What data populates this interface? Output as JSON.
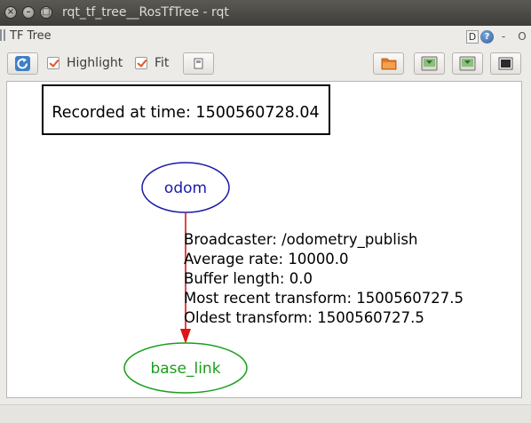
{
  "window": {
    "title": "rqt_tf_tree__RosTfTree - rqt",
    "close_glyph": "×",
    "minimize_glyph": "–",
    "maximize_glyph": "□"
  },
  "panel": {
    "title": "TF Tree",
    "d_button": "D",
    "help_button": "?",
    "dash_button": "-",
    "close_button": "O"
  },
  "toolbar": {
    "refresh_icon": "refresh-icon",
    "highlight_label": "Highlight",
    "highlight_checked": true,
    "fit_label": "Fit",
    "fit_checked": true
  },
  "graph": {
    "recorded_label": "Recorded at time: 1500560728.04",
    "nodes": {
      "parent": {
        "label": "odom",
        "color": "#1a1aa8"
      },
      "child": {
        "label": "base_link",
        "color": "#1a9e1a"
      }
    },
    "edge": {
      "color": "#e01515",
      "lines": [
        "Broadcaster: /odometry_publish",
        "Average rate: 10000.0",
        "Buffer length: 0.0",
        "Most recent transform: 1500560727.5",
        "Oldest transform: 1500560727.5"
      ]
    }
  },
  "colors": {
    "titlebar": "#4a4945",
    "accent_check": "#e2551f"
  }
}
